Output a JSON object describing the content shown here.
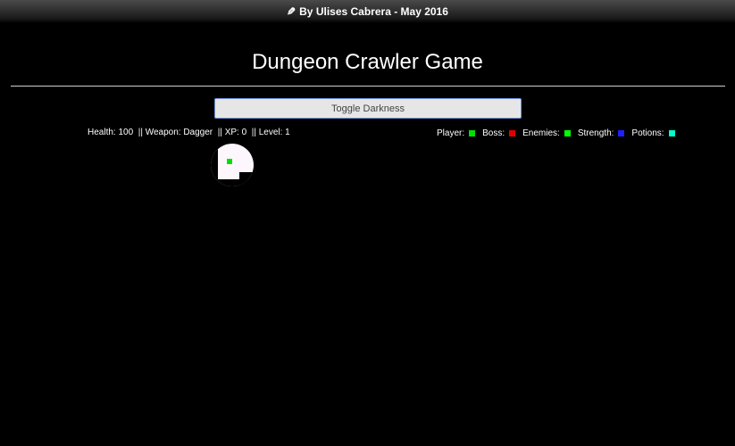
{
  "header": {
    "icon": "pencil-icon",
    "credit": "By Ulises Cabrera - May 2016"
  },
  "title": "Dungeon Crawler Game",
  "toggle_button_label": "Toggle Darkness",
  "stats": {
    "health_label": "Health:",
    "health": "100",
    "weapon_label": "Weapon:",
    "weapon": "Dagger",
    "xp_label": "XP:",
    "xp": "0",
    "level_label": "Level:",
    "level": "1",
    "separator": "||"
  },
  "legend": [
    {
      "label": "Player:",
      "color": "#00e000"
    },
    {
      "label": "Boss:",
      "color": "#e00000"
    },
    {
      "label": "Enemies:",
      "color": "#00ff00"
    },
    {
      "label": "Strength:",
      "color": "#2020ff"
    },
    {
      "label": "Potions:",
      "color": "#00ffcc"
    }
  ],
  "map": {
    "floor_color": "#fdf6fd",
    "wall_color": "#000000",
    "player_color": "#00e000"
  }
}
